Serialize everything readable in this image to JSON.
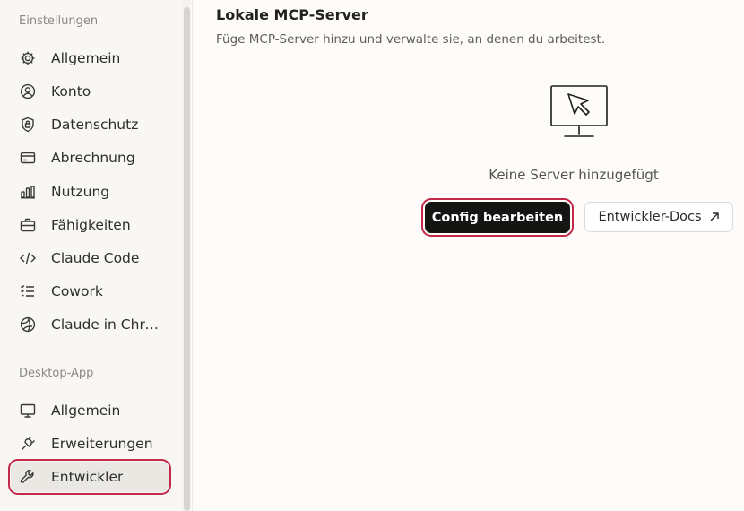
{
  "sidebar": {
    "section_settings": "Einstellungen",
    "items": [
      {
        "label": "Allgemein",
        "icon": "gear-icon"
      },
      {
        "label": "Konto",
        "icon": "user-circle-icon"
      },
      {
        "label": "Datenschutz",
        "icon": "lock-shield-icon"
      },
      {
        "label": "Abrechnung",
        "icon": "credit-card-icon"
      },
      {
        "label": "Nutzung",
        "icon": "bar-chart-icon"
      },
      {
        "label": "Fähigkeiten",
        "icon": "briefcase-icon"
      },
      {
        "label": "Claude Code",
        "icon": "code-icon"
      },
      {
        "label": "Cowork",
        "icon": "checklist-icon"
      },
      {
        "label": "Claude in Chrome",
        "icon": "globe-icon"
      }
    ],
    "section_desktop": "Desktop-App",
    "desktop_items": [
      {
        "label": "Allgemein",
        "icon": "monitor-icon"
      },
      {
        "label": "Erweiterungen",
        "icon": "plug-icon"
      },
      {
        "label": "Entwickler",
        "icon": "wrench-icon",
        "active": true
      }
    ]
  },
  "main": {
    "title": "Lokale MCP-Server",
    "subtitle": "Füge MCP-Server hinzu und verwalte sie, an denen du arbeitest.",
    "empty_text": "Keine Server hinzugefügt",
    "primary_button": "Config bearbeiten",
    "secondary_button": "Entwickler-Docs"
  },
  "colors": {
    "highlight": "#c2284a",
    "primary_button_bg": "#141413"
  }
}
